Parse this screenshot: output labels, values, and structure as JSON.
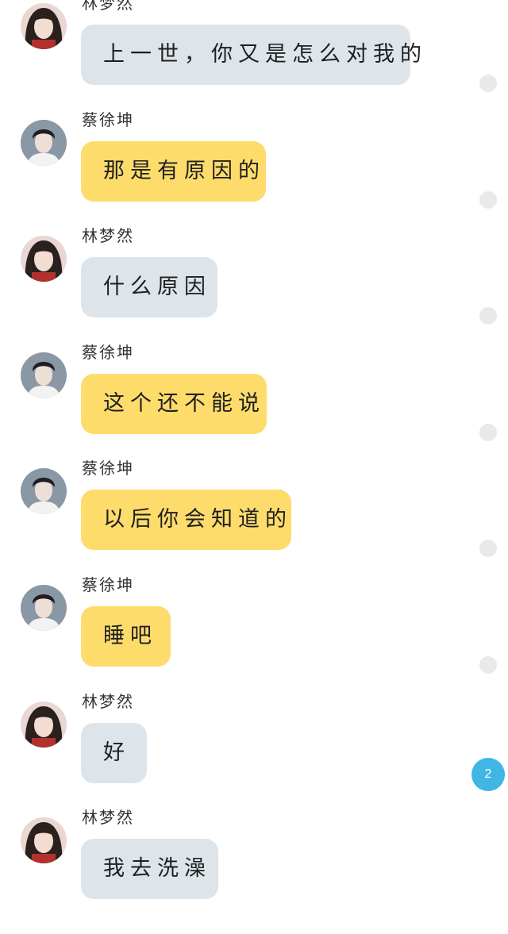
{
  "colors": {
    "gray_bubble": "#dde5ea",
    "yellow_bubble": "#fedc6c",
    "unread_badge": "#3fb6e3",
    "read_dot": "#e9e9e9"
  },
  "messages": [
    {
      "sender": "林梦然",
      "text": "上一世，你又是怎么对我的",
      "bubble": "gray",
      "avatar": "girl-avatar"
    },
    {
      "sender": "蔡徐坤",
      "text": "那是有原因的",
      "bubble": "yellow",
      "avatar": "boy-avatar"
    },
    {
      "sender": "林梦然",
      "text": "什么原因",
      "bubble": "gray",
      "avatar": "girl-avatar"
    },
    {
      "sender": "蔡徐坤",
      "text": "这个还不能说",
      "bubble": "yellow",
      "avatar": "boy-avatar"
    },
    {
      "sender": "蔡徐坤",
      "text": "以后你会知道的",
      "bubble": "yellow",
      "avatar": "boy-avatar"
    },
    {
      "sender": "蔡徐坤",
      "text": "睡吧",
      "bubble": "yellow",
      "avatar": "boy-avatar"
    },
    {
      "sender": "林梦然",
      "text": "好",
      "bubble": "gray",
      "avatar": "girl-avatar"
    },
    {
      "sender": "林梦然",
      "text": "我去洗澡",
      "bubble": "gray",
      "avatar": "girl-avatar"
    }
  ],
  "unread_badge": {
    "count": "2"
  }
}
